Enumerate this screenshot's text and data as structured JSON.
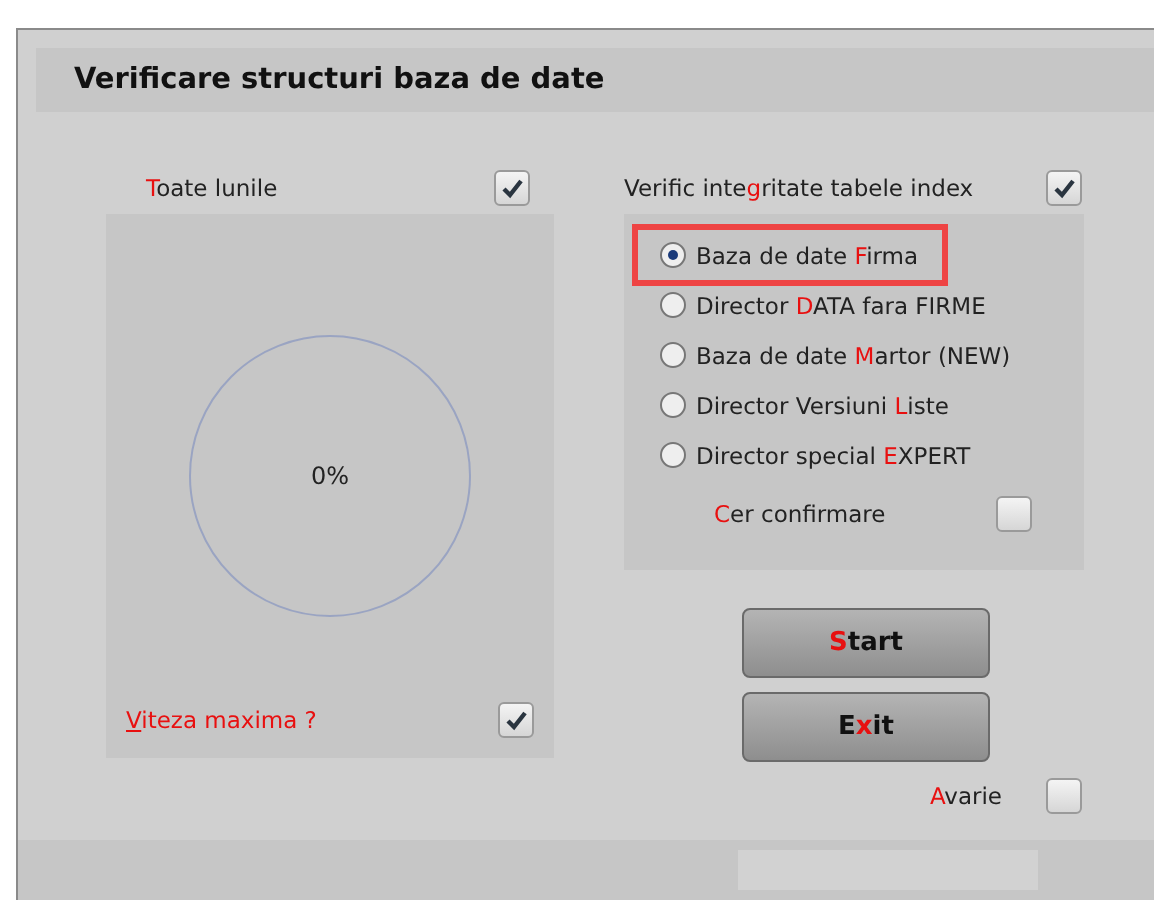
{
  "window": {
    "title": "Verificare structuri baza de date"
  },
  "all_months": {
    "label": {
      "key": "T",
      "post": "oate lunile"
    },
    "checked": true
  },
  "progress": {
    "level": 0,
    "reading": "0%"
  },
  "max_speed": {
    "label": {
      "key": "V",
      "post": "iteza maxima ?"
    },
    "highlighted": true,
    "checked": true
  },
  "verify_index": {
    "label": {
      "pre": "Verific inte",
      "key": "g",
      "post": "ritate tabele index"
    },
    "checked": true
  },
  "sources": [
    {
      "label": {
        "pre": "Baza de date ",
        "key": "F",
        "post": "irma"
      },
      "selected": true
    },
    {
      "label": {
        "pre": "Director ",
        "key": "D",
        "post": "ATA fara FIRME"
      },
      "selected": false
    },
    {
      "label": {
        "pre": "Baza de date ",
        "key": "M",
        "post": "artor (NEW)"
      },
      "selected": false
    },
    {
      "label": {
        "pre": "Director Versiuni ",
        "key": "L",
        "post": "iste"
      },
      "selected": false
    },
    {
      "label": {
        "pre": "Director special ",
        "key": "E",
        "post": "XPERT"
      },
      "selected": false
    }
  ],
  "confirm": {
    "label": {
      "key": "C",
      "post": "er confirmare"
    },
    "checked": false
  },
  "buttons": [
    {
      "label": {
        "key": "S",
        "post": "tart"
      }
    },
    {
      "label": {
        "pre": "E",
        "key": "x",
        "post": "it"
      }
    }
  ],
  "failure": {
    "label": {
      "key": "A",
      "post": "varie"
    },
    "checked": false
  }
}
